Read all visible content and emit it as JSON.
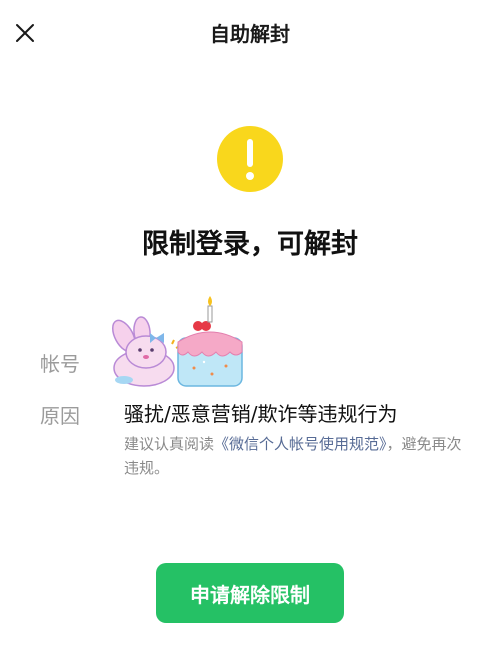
{
  "nav": {
    "title": "自助解封",
    "close_icon": "close-icon"
  },
  "status": {
    "icon": "warning-icon",
    "icon_color": "#f9d71c",
    "headline": "限制登录，可解封"
  },
  "details": {
    "account_label": "帐号",
    "avatar_icon": "bunny-birthday-cake-avatar",
    "reason_label": "原因",
    "reason_value": "骚扰/恶意营销/欺诈等违规行为",
    "advice_prefix": "建议认真阅读",
    "advice_link": "《微信个人帐号使用规范》",
    "advice_suffix": "，避免再次违规。"
  },
  "action": {
    "button_label": "申请解除限制",
    "button_color": "#25c165"
  }
}
